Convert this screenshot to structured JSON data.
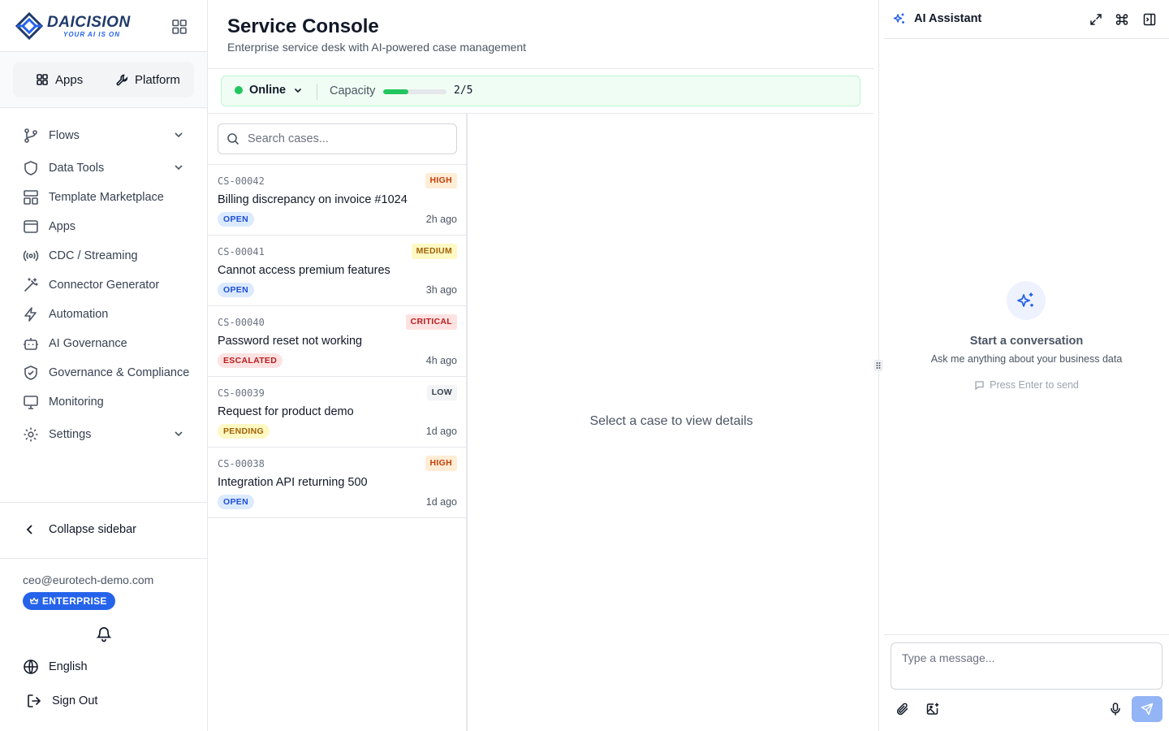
{
  "brand": {
    "name": "DAICISION",
    "tagline": "YOUR AI IS ON"
  },
  "switcher": {
    "apps_label": "Apps",
    "platform_label": "Platform"
  },
  "nav": {
    "items": [
      {
        "label": "Flows",
        "icon": "git-branch-icon",
        "expandable": true
      },
      {
        "label": "Data Tools",
        "icon": "shield-icon",
        "expandable": true
      },
      {
        "label": "Template Marketplace",
        "icon": "layout-template-icon",
        "expandable": false
      },
      {
        "label": "Apps",
        "icon": "app-window-icon",
        "expandable": false
      },
      {
        "label": "CDC / Streaming",
        "icon": "radio-broadcast-icon",
        "expandable": false
      },
      {
        "label": "Connector Generator",
        "icon": "magic-wand-icon",
        "expandable": false
      },
      {
        "label": "Automation",
        "icon": "lightning-icon",
        "expandable": false
      },
      {
        "label": "AI Governance",
        "icon": "bot-icon",
        "expandable": false
      },
      {
        "label": "Governance & Compliance",
        "icon": "shield-check-icon",
        "expandable": false
      },
      {
        "label": "Monitoring",
        "icon": "monitor-icon",
        "expandable": false
      },
      {
        "label": "Settings",
        "icon": "gear-icon",
        "expandable": true
      }
    ]
  },
  "sidebar_footer": {
    "collapse_label": "Collapse sidebar",
    "email": "ceo@eurotech-demo.com",
    "plan": "ENTERPRISE",
    "language": "English",
    "signout": "Sign Out"
  },
  "header": {
    "title": "Service Console",
    "subtitle": "Enterprise service desk with AI-powered case management"
  },
  "agent_status": {
    "status": "Online",
    "capacity_label": "Capacity",
    "capacity_used": 2,
    "capacity_total": 5,
    "capacity_text": "2/5",
    "status_color": "#22c55e"
  },
  "search": {
    "placeholder": "Search cases..."
  },
  "cases": [
    {
      "id": "CS-00042",
      "priority": "HIGH",
      "title": "Billing discrepancy on invoice #1024",
      "status": "OPEN",
      "age": "2h ago"
    },
    {
      "id": "CS-00041",
      "priority": "MEDIUM",
      "title": "Cannot access premium features",
      "status": "OPEN",
      "age": "3h ago"
    },
    {
      "id": "CS-00040",
      "priority": "CRITICAL",
      "title": "Password reset not working",
      "status": "ESCALATED",
      "age": "4h ago"
    },
    {
      "id": "CS-00039",
      "priority": "LOW",
      "title": "Request for product demo",
      "status": "PENDING",
      "age": "1d ago"
    },
    {
      "id": "CS-00038",
      "priority": "HIGH",
      "title": "Integration API returning 500",
      "status": "OPEN",
      "age": "1d ago"
    }
  ],
  "priority_colors": {
    "HIGH": {
      "bg": "#ffedd5",
      "fg": "#c2410c"
    },
    "MEDIUM": {
      "bg": "#fef9c3",
      "fg": "#a16207"
    },
    "CRITICAL": {
      "bg": "#fee2e2",
      "fg": "#b91c1c"
    },
    "LOW": {
      "bg": "#f3f4f6",
      "fg": "#374151"
    }
  },
  "status_colors": {
    "OPEN": {
      "bg": "#dbeafe",
      "fg": "#1d4ed8"
    },
    "ESCALATED": {
      "bg": "#fee2e2",
      "fg": "#b91c1c"
    },
    "PENDING": {
      "bg": "#fef9c3",
      "fg": "#a16207"
    }
  },
  "detail": {
    "empty_text": "Select a case to view details"
  },
  "ai_assistant": {
    "title": "AI Assistant",
    "empty_title": "Start a conversation",
    "empty_subtitle": "Ask me anything about your business data",
    "hint": "Press Enter to send",
    "input_placeholder": "Type a message..."
  },
  "colors": {
    "accent": "#2563eb",
    "success": "#22c55e"
  }
}
